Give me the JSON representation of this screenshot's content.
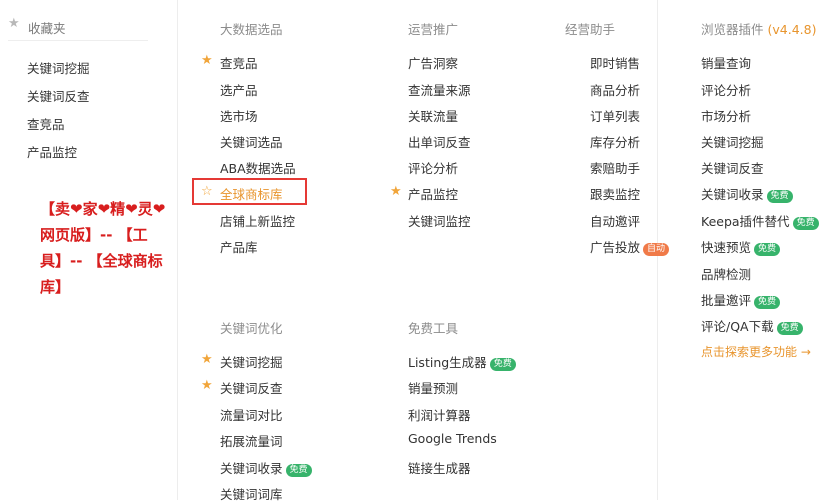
{
  "favorites": {
    "title": "收藏夹",
    "items": [
      "关键词挖掘",
      "关键词反查",
      "查竞品",
      "产品监控"
    ]
  },
  "big_data": {
    "title": "大数据选品",
    "items": [
      "查竞品",
      "选产品",
      "选市场",
      "关键词选品",
      "ABA数据选品",
      "全球商标库",
      "店铺上新监控",
      "产品库"
    ]
  },
  "operations": {
    "title": "运营推广",
    "items": [
      "广告洞察",
      "查流量来源",
      "关联流量",
      "出单词反查",
      "评论分析",
      "产品监控",
      "关键词监控"
    ]
  },
  "assistant": {
    "title": "经营助手",
    "items": [
      "即时销售",
      "商品分析",
      "订单列表",
      "库存分析",
      "索赔助手",
      "跟卖监控",
      "自动邀评",
      "广告投放"
    ],
    "badge_auto": "自动"
  },
  "plugin": {
    "title": "浏览器插件",
    "version": "(v4.4.8)",
    "items": [
      "销量查询",
      "评论分析",
      "市场分析",
      "关键词挖掘",
      "关键词反查",
      "关键词收录",
      "Keepa插件替代",
      "快速预览",
      "品牌检测",
      "批量邀评",
      "评论/QA下载"
    ],
    "more": "点击探索更多功能 →"
  },
  "keyword_opt": {
    "title": "关键词优化",
    "items": [
      "关键词挖掘",
      "关键词反查",
      "流量词对比",
      "拓展流量词",
      "关键词收录",
      "关键词词库"
    ]
  },
  "free_tools": {
    "title": "免费工具",
    "items": [
      "Listing生成器",
      "销量预测",
      "利润计算器",
      "Google Trends",
      "链接生成器"
    ]
  },
  "badge_free": "免费",
  "annotation": "【卖❤家❤精❤灵❤网页版】-- 【工具】-- 【全球商标库】",
  "colors": {
    "accent": "#e8952e",
    "free_badge": "#37b36b",
    "auto_badge": "#f07a48",
    "highlight_box": "#e53935",
    "annotation": "#d81e1e"
  }
}
